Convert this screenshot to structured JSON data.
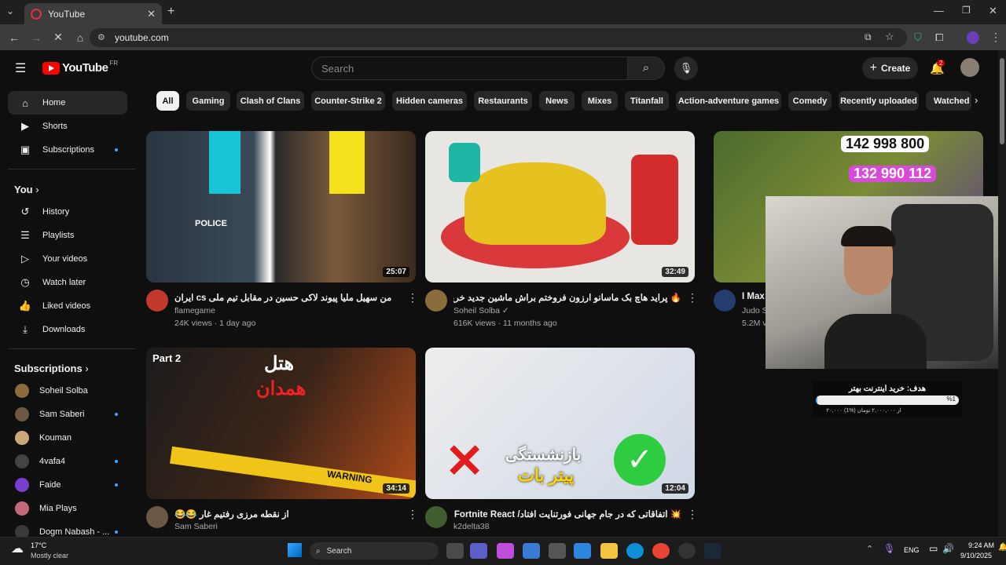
{
  "browser": {
    "tab_title": "YouTube",
    "url": "youtube.com"
  },
  "header": {
    "logo_text": "YouTube",
    "region": "FR",
    "search_placeholder": "Search",
    "create_label": "Create",
    "notifications_count": "2"
  },
  "sidebar": {
    "main": [
      {
        "label": "Home",
        "icon": "home-icon"
      },
      {
        "label": "Shorts",
        "icon": "shorts-icon"
      },
      {
        "label": "Subscriptions",
        "icon": "subscriptions-icon"
      }
    ],
    "you_header": "You",
    "you_items": [
      {
        "label": "History",
        "icon": "history-icon"
      },
      {
        "label": "Playlists",
        "icon": "playlists-icon"
      },
      {
        "label": "Your videos",
        "icon": "your-videos-icon"
      },
      {
        "label": "Watch later",
        "icon": "watch-later-icon"
      },
      {
        "label": "Liked videos",
        "icon": "liked-videos-icon"
      },
      {
        "label": "Downloads",
        "icon": "downloads-icon"
      }
    ],
    "subs_header": "Subscriptions",
    "subs": [
      {
        "label": "Soheil Solba",
        "color": "#8a6d3b"
      },
      {
        "label": "Sam Saberi",
        "color": "#6b5844"
      },
      {
        "label": "Kouman",
        "color": "#c9a77b"
      },
      {
        "label": "4vafa4",
        "color": "#444"
      },
      {
        "label": "Faide",
        "color": "#7b3fd0"
      },
      {
        "label": "Mia Plays",
        "color": "#c26a7a"
      },
      {
        "label": "Dogm Nabash - ...",
        "color": "#3a3a3a"
      }
    ]
  },
  "chips": [
    "All",
    "Gaming",
    "Clash of Clans",
    "Counter-Strike 2",
    "Hidden cameras",
    "Restaurants",
    "News",
    "Mixes",
    "Titanfall",
    "Action-adventure games",
    "Comedy",
    "Recently uploaded",
    "Watched"
  ],
  "videos": [
    {
      "title": "من سهیل ملیا پیوند لاکی حسین در مقابل تیم ملی cs ایران",
      "channel": "flamegame",
      "meta": "24K views · 1 day ago",
      "duration": "25:07",
      "thumb_text": "POLICE"
    },
    {
      "title": "🔥 پراید هاچ بک ماسانو ارزون فروختم براش ماشین جدید خریدم",
      "channel": "Soheil Solba",
      "meta": "616K views · 11 months ago",
      "duration": "32:49",
      "thumb_text": ""
    },
    {
      "title": "I Max",
      "channel": "Judo S",
      "meta": "5.2M v",
      "duration": "",
      "thumb_text": "142 998 800",
      "thumb_text2": "132 990 112"
    },
    {
      "title": "از نقطه مرزی رفتیم غار 😂😂",
      "channel": "Sam Saberi",
      "meta": "",
      "duration": "34:14",
      "thumb_text": "Part 2",
      "thumb_text2": "هتل",
      "thumb_text3": "همدان",
      "thumb_text4": "WARNING"
    },
    {
      "title": "💥 اتفاقاتی که در جام جهانی فورتنایت افتاد/ Fortnite React 💥",
      "channel": "k2delta38",
      "meta": "",
      "duration": "12:04",
      "thumb_text": "بازنشستگی",
      "thumb_text2": "پیتر بات"
    }
  ],
  "overlay": {
    "goal_title": "هدف: خرید اینترنت بهتر",
    "goal_percent": "%1",
    "goal_amount": "۲۰,۰۰۰ از ۲,۰۰۰,۰۰۰ تومان (%1)"
  },
  "taskbar": {
    "temp": "17°C",
    "weather": "Mostly clear",
    "search_label": "Search",
    "lang": "ENG",
    "time": "9:24 AM",
    "date": "9/10/2025"
  }
}
